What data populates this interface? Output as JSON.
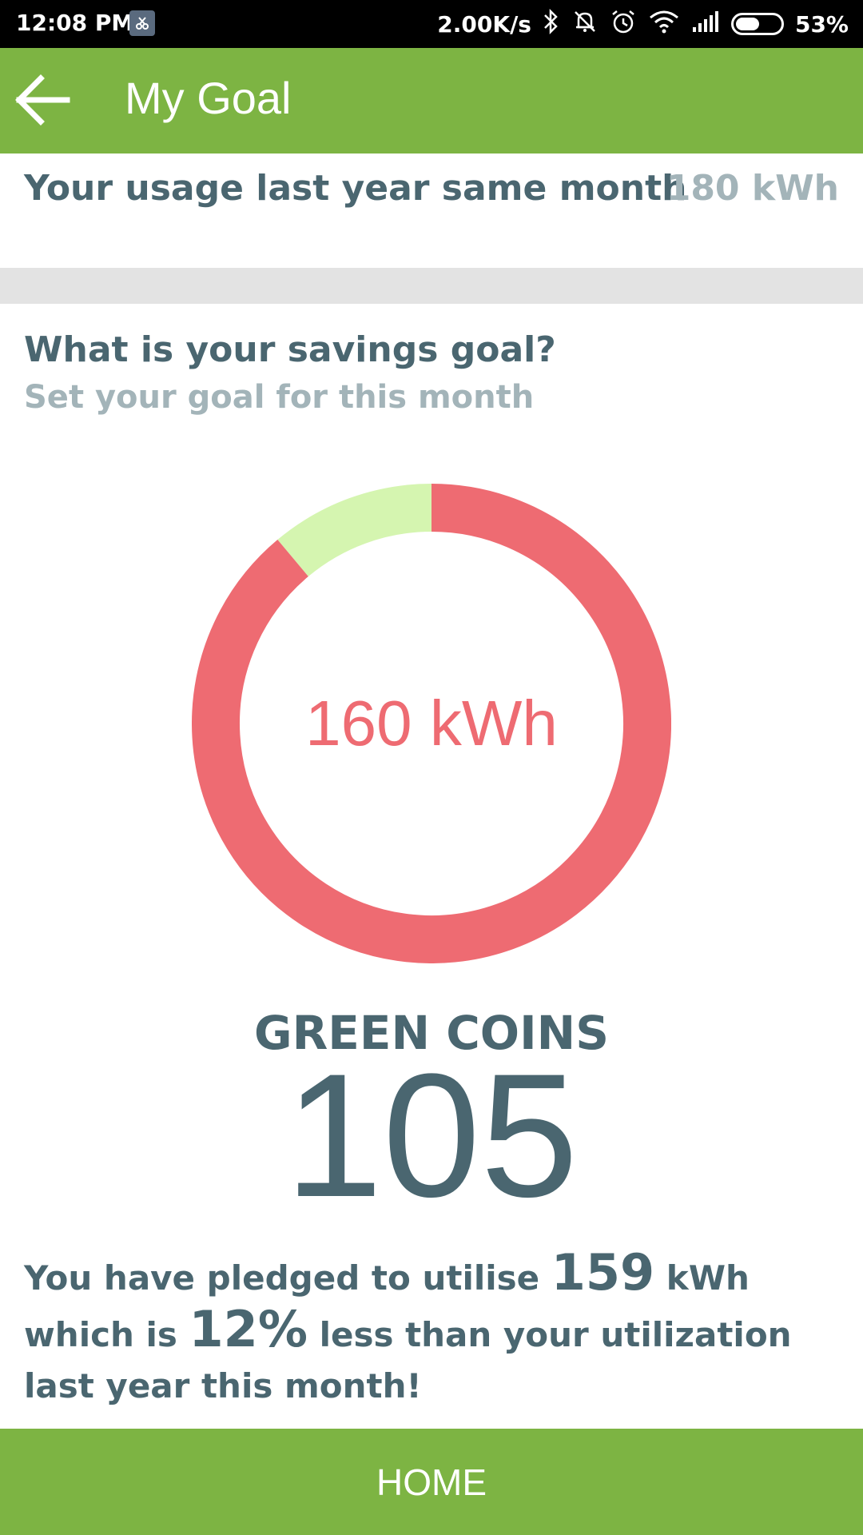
{
  "status_bar": {
    "time": "12:08 PM",
    "network_speed": "2.00K/s",
    "battery_percent": "53%",
    "battery_level": 0.53,
    "icons": [
      "notification-icon",
      "bluetooth-icon",
      "mute-icon",
      "alarm-icon",
      "wifi-icon",
      "signal-icon",
      "battery-icon"
    ]
  },
  "app_bar": {
    "title": "My Goal",
    "back_icon": "arrow-left-icon",
    "color": "#7db443"
  },
  "usage": {
    "label": "Your usage last year same month",
    "value": "180 kWh"
  },
  "goal": {
    "title": "What is your savings goal?",
    "subtitle": "Set your goal for this month",
    "donut_value": "160 kWh",
    "goal_fraction": 0.889,
    "colors": {
      "goal": "#ee6b72",
      "savings": "#d5f5b0"
    }
  },
  "coins": {
    "label": "GREEN COINS",
    "value": "105"
  },
  "pledge": {
    "prefix": "You have pledged to utilise",
    "kwh": "159",
    "middle": "kWh which is",
    "percent": "12%",
    "suffix": "less than your utilization last year this month!"
  },
  "home_button": {
    "label": "HOME"
  }
}
